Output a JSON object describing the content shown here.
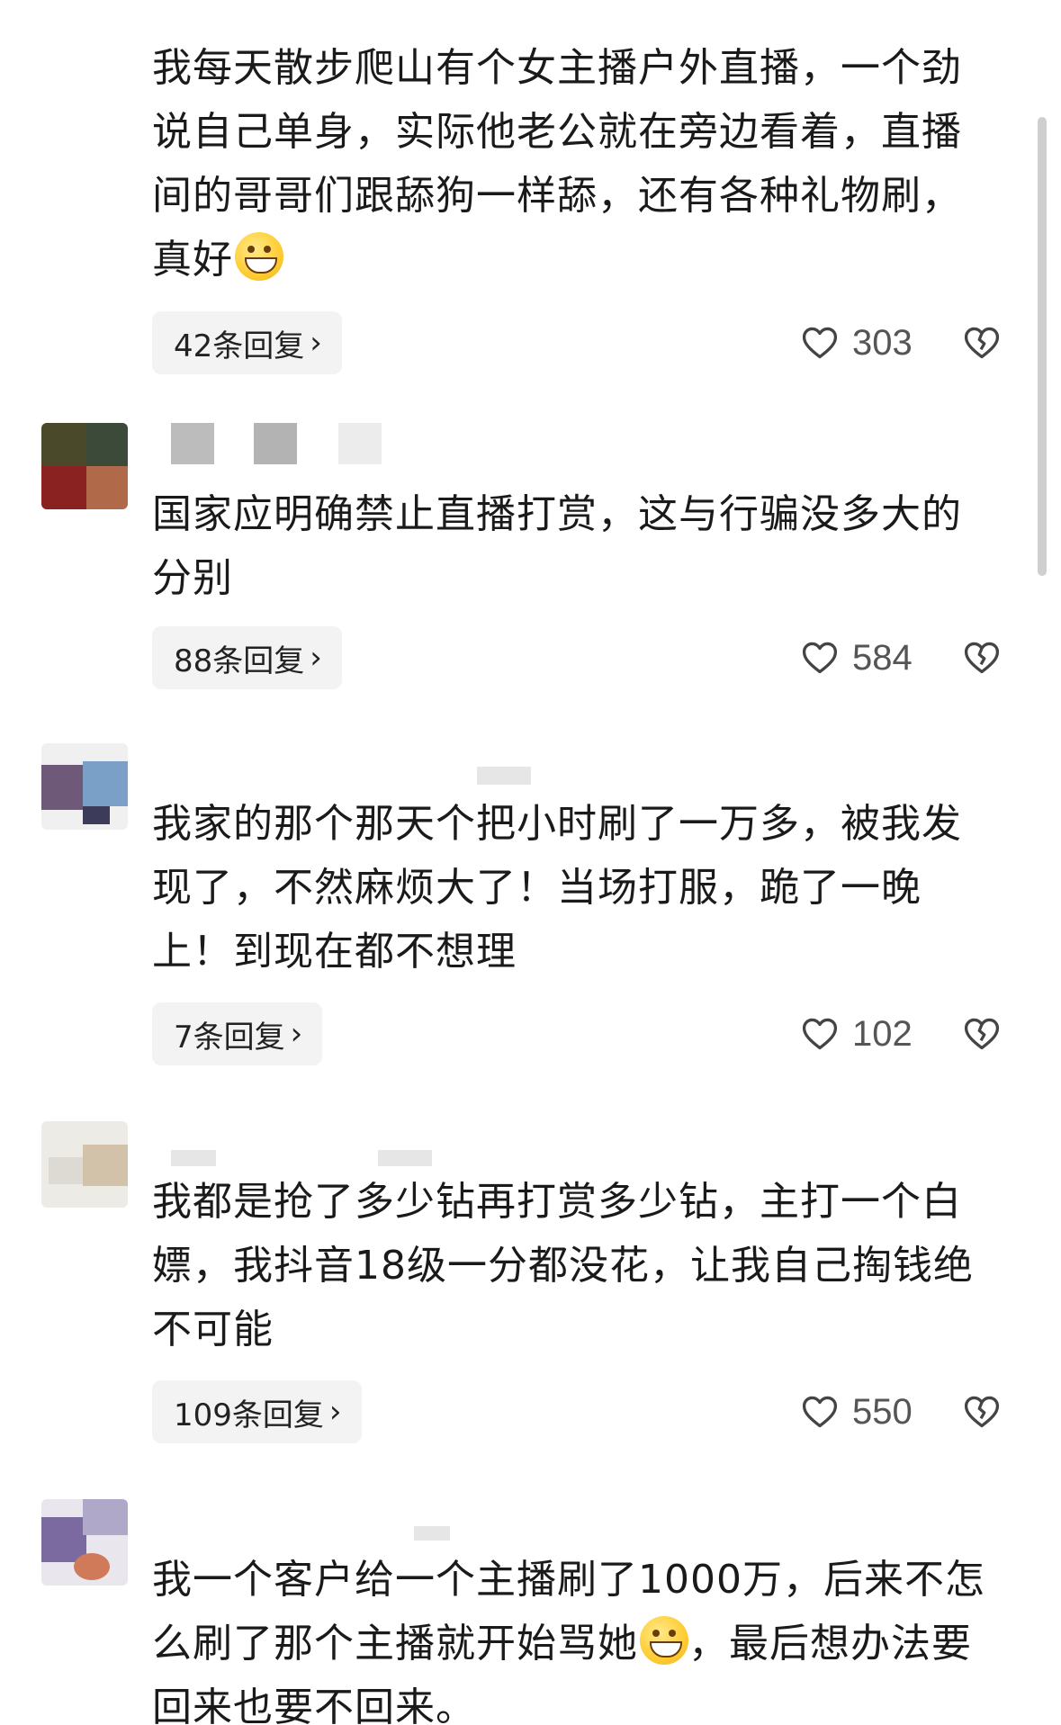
{
  "comments": [
    {
      "text_before_emoji": "我每天散步爬山有个女主播户外直播，一个劲说自己单身，实际他老公就在旁边看着，直播间的哥哥们跟舔狗一样舔，还有各种礼物刷，真好",
      "emoji": "grinning-face-emoji",
      "text_after_emoji": "",
      "replies": "42条回复",
      "likes": "303"
    },
    {
      "text_before_emoji": "国家应明确禁止直播打赏，这与行骗没多大的分别",
      "text_after_emoji": "",
      "replies": "88条回复",
      "likes": "584"
    },
    {
      "text_before_emoji": "我家的那个那天个把小时刷了一万多，被我发现了，不然麻烦大了！当场打服，跪了一晚上！到现在都不想理",
      "text_after_emoji": "",
      "replies": "7条回复",
      "likes": "102"
    },
    {
      "text_before_emoji": "我都是抢了多少钻再打赏多少钻，主打一个白嫖，我抖音18级一分都没花，让我自己掏钱绝不可能",
      "text_after_emoji": "",
      "replies": "109条回复",
      "likes": "550"
    },
    {
      "text_before_emoji": "我一个客户给一个主播刷了1000万，后来不怎么刷了那个主播就开始骂她",
      "emoji": "laughing-face-emoji",
      "text_after_emoji": "，最后想办法要回来也要不回来。",
      "replies": "",
      "likes": ""
    }
  ],
  "colors": {
    "text": "#1a1a1a",
    "pill_bg": "#f3f3f3",
    "like_count": "#555555",
    "scrollbar": "#cfcfcf"
  },
  "icons": {
    "like": "heart-outline-icon",
    "dislike": "broken-heart-icon",
    "chevron": "chevron-right-icon"
  }
}
